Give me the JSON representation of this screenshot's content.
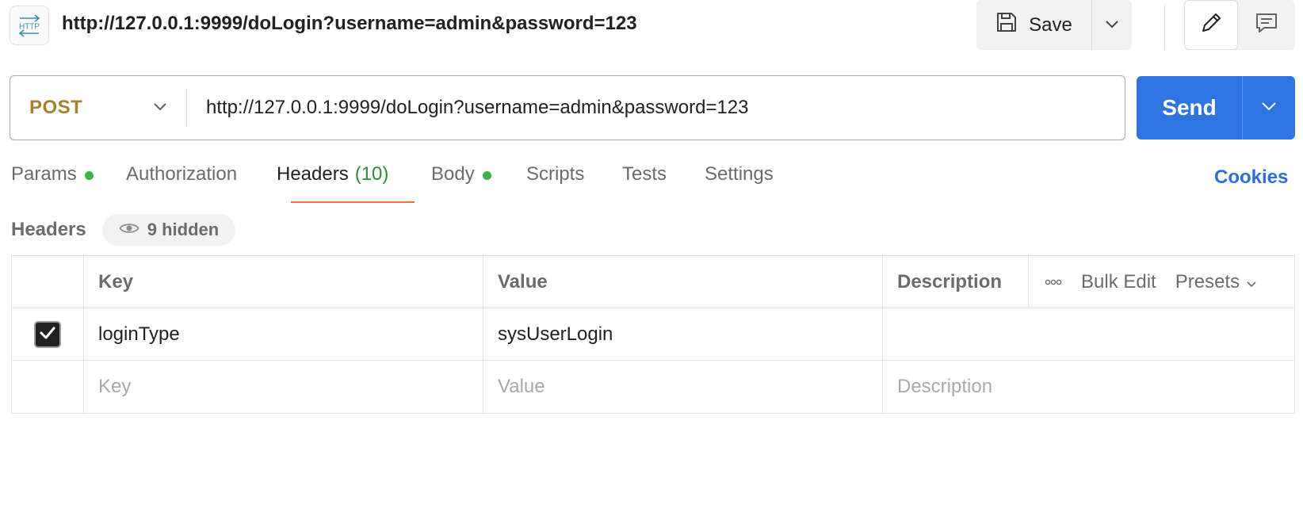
{
  "colors": {
    "method": "#a5812a",
    "send": "#2f74e0",
    "active_tab_underline": "#f26b3a",
    "dot": "#3bb54a",
    "count": "#2e8b3a",
    "cookies": "#2f6fd6"
  },
  "header": {
    "icon": "http-icon",
    "title": "http://127.0.0.1:9999/doLogin?username=admin&password=123",
    "save_label": "Save"
  },
  "request": {
    "method": "POST",
    "url": "http://127.0.0.1:9999/doLogin?username=admin&password=123",
    "send_label": "Send"
  },
  "tabs": [
    {
      "label": "Params",
      "dot": true
    },
    {
      "label": "Authorization"
    },
    {
      "label": "Headers",
      "count": "(10)",
      "active": true
    },
    {
      "label": "Body",
      "dot": true
    },
    {
      "label": "Scripts"
    },
    {
      "label": "Tests"
    },
    {
      "label": "Settings"
    }
  ],
  "cookies_label": "Cookies",
  "headers_section": {
    "title": "Headers",
    "hidden_label": "9 hidden"
  },
  "table": {
    "columns": {
      "key": "Key",
      "value": "Value",
      "description": "Description"
    },
    "actions": {
      "bulk_edit": "Bulk Edit",
      "presets": "Presets"
    },
    "rows": [
      {
        "checked": true,
        "key": "loginType",
        "value": "sysUserLogin",
        "description": ""
      }
    ],
    "placeholders": {
      "key": "Key",
      "value": "Value",
      "description": "Description"
    }
  }
}
